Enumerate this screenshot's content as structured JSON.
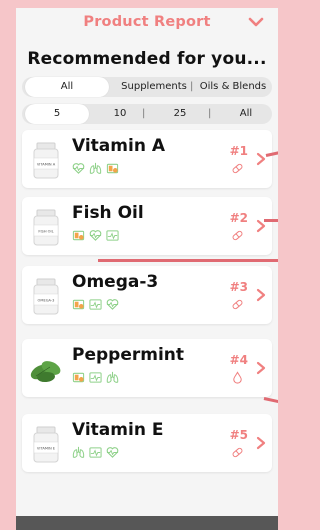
{
  "header": {
    "title": "Product Report"
  },
  "heading": "Recommended for you...",
  "category_filter": {
    "options": [
      "All",
      "Supplements",
      "Oils & Blends"
    ],
    "selected": "All"
  },
  "count_filter": {
    "options": [
      "5",
      "10",
      "25",
      "All"
    ],
    "selected": "5"
  },
  "products": [
    {
      "name": "Vitamin A",
      "rank": "#1",
      "label_text": "VITAMIN A",
      "benefits": [
        "heart-pulse-icon",
        "lungs-icon",
        "battery-icon"
      ],
      "form": "capsule-icon"
    },
    {
      "name": "Fish Oil",
      "rank": "#2",
      "label_text": "FISH OIL",
      "benefits": [
        "battery-icon",
        "heart-pulse-icon",
        "ecg-icon"
      ],
      "form": "capsule-icon"
    },
    {
      "name": "Omega-3",
      "rank": "#3",
      "label_text": "OMEGA-3",
      "benefits": [
        "battery-icon",
        "ecg-icon",
        "heart-pulse-icon"
      ],
      "form": "capsule-icon"
    },
    {
      "name": "Peppermint",
      "rank": "#4",
      "label_text": "",
      "benefits": [
        "battery-icon",
        "ecg-icon",
        "lungs-icon"
      ],
      "form": "drop-icon"
    },
    {
      "name": "Vitamin E",
      "rank": "#5",
      "label_text": "VITAMIN E",
      "benefits": [
        "lungs-icon",
        "ecg-icon",
        "heart-pulse-icon"
      ],
      "form": "capsule-icon"
    }
  ],
  "colors": {
    "background": "#f6c6c9",
    "accent": "#f08080",
    "benefit_green": "#8fd18a",
    "benefit_orange": "#f2a54a",
    "line": "#e06a72"
  }
}
